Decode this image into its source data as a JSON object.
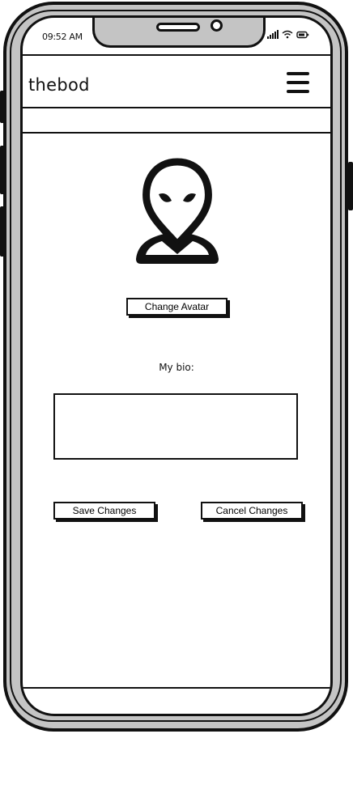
{
  "status_bar": {
    "time": "09:52 AM",
    "icons": [
      "signal-icon",
      "wifi-icon",
      "battery-icon"
    ]
  },
  "header": {
    "title": "thebod",
    "menu_icon": "hamburger-menu-icon"
  },
  "profile": {
    "avatar_icon": "alien-avatar-icon",
    "change_avatar_label": "Change Avatar",
    "bio_label": "My bio:",
    "bio_value": ""
  },
  "actions": {
    "save_label": "Save Changes",
    "cancel_label": "Cancel Changes"
  }
}
